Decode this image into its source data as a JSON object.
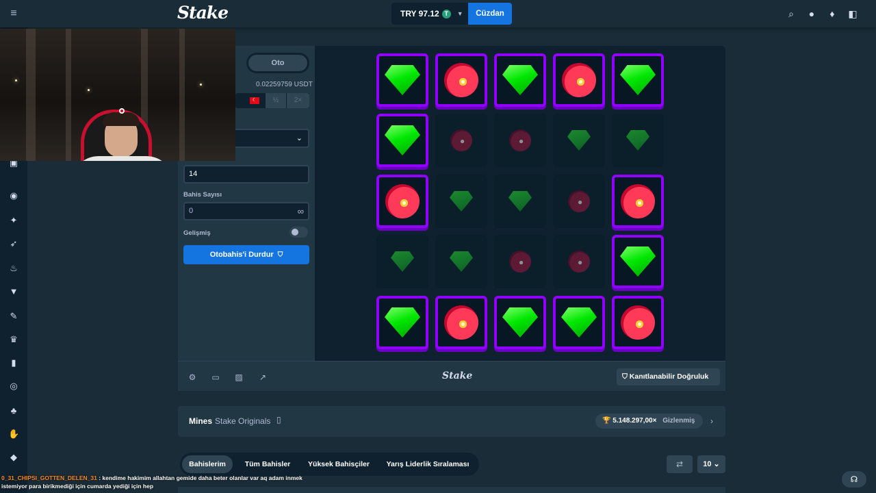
{
  "header": {
    "logo": "Stake",
    "balance": "TRY 97.12",
    "coin_symbol": "T",
    "wallet_label": "Cüzdan",
    "icons": [
      "search-icon",
      "user-icon",
      "notifications-icon",
      "sidebar-toggle-icon"
    ]
  },
  "sidebar": {
    "icons": [
      "menu-icon",
      "casino-icon",
      "sports-icon",
      "promo-icon",
      "racing-icon",
      "fire-icon",
      "tshirt-icon",
      "pen-icon",
      "crown-icon",
      "battery-icon",
      "lifebuoy-icon",
      "gift-icon",
      "hand-icon",
      "diamond-icon"
    ]
  },
  "controls": {
    "mode_auto": "Oto",
    "bet_amount_usdt": "0.02259759 USDT",
    "half_label": "½",
    "double_label": "2×",
    "gems_value": "14",
    "bets_label": "Bahis Sayısı",
    "bets_value": "0",
    "advanced_label": "Gelişmiş",
    "stop_autobet_label": "Otobahis'i Durdur"
  },
  "game": {
    "grid": [
      [
        "gem",
        "mine",
        "gem",
        "mine",
        "gem"
      ],
      [
        "gem",
        "mine-hidden",
        "mine-hidden",
        "gem-hidden",
        "gem-hidden"
      ],
      [
        "mine",
        "gem-hidden",
        "gem-hidden",
        "mine-hidden",
        "mine"
      ],
      [
        "gem-hidden",
        "gem-hidden",
        "mine-hidden",
        "mine-hidden",
        "gem"
      ],
      [
        "gem",
        "mine",
        "gem",
        "gem",
        "mine"
      ]
    ],
    "accent_color": "#9000ff",
    "gem_color": "#00e701",
    "mine_color": "#ff3a58"
  },
  "game_footer": {
    "logo": "Stake",
    "fairness_label": "Kanıtlanabilir Doğruluk"
  },
  "info": {
    "title": "Mines",
    "subtitle": "Stake Originals",
    "record_value": "5.148.297,00×",
    "record_hidden": "Gizlenmiş"
  },
  "tabs": [
    "Bahislerim",
    "Tüm Bahisler",
    "Yüksek Bahisçiler",
    "Yarış Liderlik Sıralaması"
  ],
  "rows_count": "10",
  "chat": {
    "line1_user": "0_31_CHIPSI_GOTTEN_DELEN_31",
    "line1_text": ": kendime hakimim allahtan",
    "line1_more": "gemide daha beter olanlar var aq adam inmek",
    "line2_text": "istemiyor para birikmediği için cumarda yediği için hep"
  }
}
